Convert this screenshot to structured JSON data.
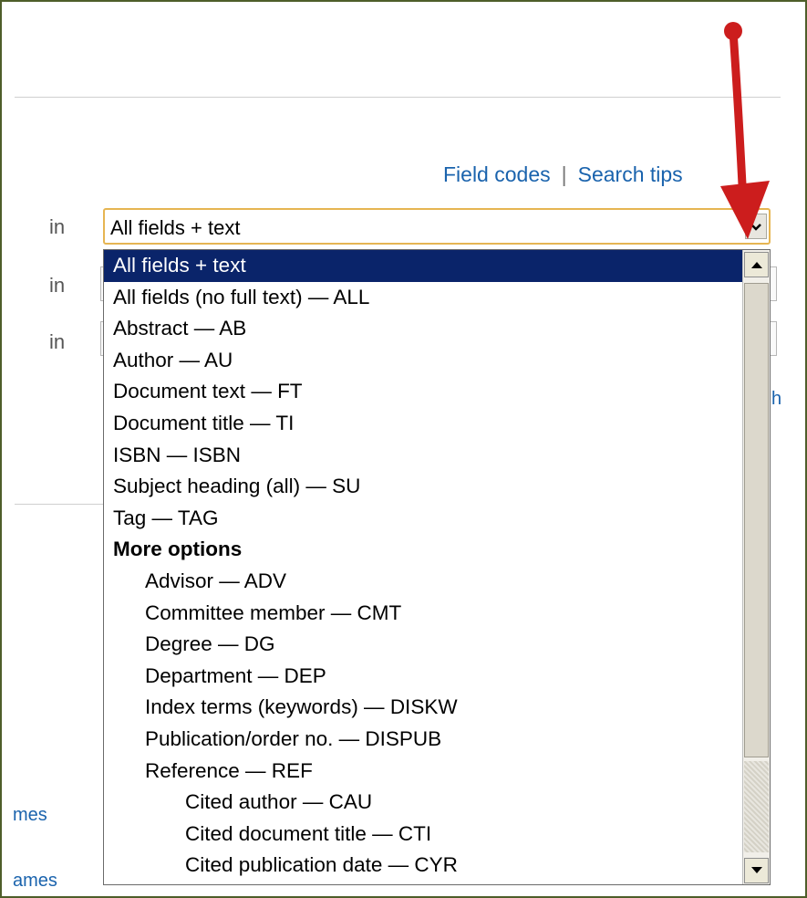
{
  "links": {
    "field_codes": "Field codes",
    "separator": "|",
    "search_tips": "Search tips"
  },
  "form": {
    "in_label": "in",
    "selected_field": "All fields + text"
  },
  "edge_links": [
    "mes",
    "ames",
    "h"
  ],
  "dropdown": {
    "options": [
      {
        "label": "All fields + text",
        "level": 0,
        "selected": true
      },
      {
        "label": "All fields (no full text) — ALL",
        "level": 0
      },
      {
        "label": "Abstract — AB",
        "level": 0
      },
      {
        "label": "Author — AU",
        "level": 0
      },
      {
        "label": "Document text — FT",
        "level": 0
      },
      {
        "label": "Document title — TI",
        "level": 0
      },
      {
        "label": "ISBN — ISBN",
        "level": 0
      },
      {
        "label": "Subject heading (all) — SU",
        "level": 0
      },
      {
        "label": "Tag — TAG",
        "level": 0
      },
      {
        "label": "More options",
        "level": 0,
        "group": true
      },
      {
        "label": "Advisor — ADV",
        "level": 1
      },
      {
        "label": "Committee member — CMT",
        "level": 1
      },
      {
        "label": "Degree — DG",
        "level": 1
      },
      {
        "label": "Department — DEP",
        "level": 1
      },
      {
        "label": "Index terms (keywords) — DISKW",
        "level": 1
      },
      {
        "label": "Publication/order no. — DISPUB",
        "level": 1
      },
      {
        "label": "Reference — REF",
        "level": 1
      },
      {
        "label": "Cited author — CAU",
        "level": 2
      },
      {
        "label": "Cited document title — CTI",
        "level": 2
      },
      {
        "label": "Cited publication date — CYR",
        "level": 2
      }
    ]
  },
  "colors": {
    "selection_bg": "#0a246a",
    "link": "#1a63ad",
    "annotation_arrow": "#cc1d1d",
    "select_focus_border": "#e6b552"
  },
  "icons": {
    "dropdown_arrow": "chevron-down-icon",
    "scroll_up": "triangle-up-icon",
    "scroll_down": "triangle-down-icon",
    "annotation": "red-arrow-icon"
  }
}
